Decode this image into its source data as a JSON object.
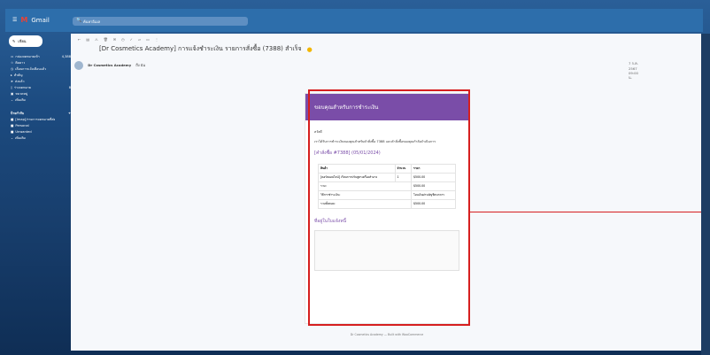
{
  "app": {
    "name": "Gmail",
    "compose": "เขียน"
  },
  "search": {
    "placeholder": "ค้นหาอีเมล"
  },
  "sidebar": {
    "items": [
      {
        "label": "กล่องจดหมายเข้า",
        "count": "4,388",
        "icon": "inbox-icon"
      },
      {
        "label": "ติดดาว",
        "icon": "star-icon"
      },
      {
        "label": "เลื่อนการแจ้งเตือนแล้ว",
        "icon": "clock-icon"
      },
      {
        "label": "สำคัญ",
        "icon": "important-icon"
      },
      {
        "label": "ส่งแล้ว",
        "icon": "send-icon"
      },
      {
        "label": "ร่างจดหมาย",
        "count": "8",
        "icon": "draft-icon"
      },
      {
        "label": "หมวดหมู่",
        "icon": "category-icon"
      },
      {
        "label": "เพิ่มเติม",
        "icon": "more-icon"
      }
    ],
    "labels_title": "ป้ายกำกับ",
    "labels": [
      {
        "label": "[Imap]/รายการจดหมายที่ส่ง",
        "color": "#ffffff"
      },
      {
        "label": "Personal",
        "color": "#ffffff"
      },
      {
        "label": "Unwanted",
        "color": "#ffffff"
      },
      {
        "label": "เพิ่มเติม",
        "color": "#ffffff"
      }
    ]
  },
  "email": {
    "subject": "[Dr Cosmetics Academy] การแจ้งชำระเงิน รายการสั่งซื้อ (7388) สำเร็จ",
    "sender": "Dr Cosmetics Academy",
    "to": "ถึง ฉัน",
    "date": "7 ก.ค. 2567 09:00 น.",
    "header_title": "ขอบคุณสำหรับการชำระเงิน",
    "greeting": "สวัสดี",
    "body_text": "เราได้รับการชำระเงินของคุณสำหรับคำสั่งซื้อ 7388 และคำสั่งซื้อของคุณกำลังดำเนินการ",
    "order_title": "[คำสั่งซื้อ #7388] (05/01/2024)",
    "table_headers": [
      "สินค้า",
      "จำนวน",
      "ราคา"
    ],
    "items": [
      {
        "name": "[คอร์สออนไลน์] เรียนการปรับสูตรเครื่องสำอาง",
        "qty": "1",
        "price": "$500.00"
      }
    ],
    "rows": [
      {
        "label": "รวม:",
        "value": "$500.00"
      },
      {
        "label": "วิธีการชำระเงิน:",
        "value": "โอนเงินผ่านบัญชีธนาคาร"
      },
      {
        "label": "รวมทั้งหมด:",
        "value": "$500.00"
      }
    ],
    "address_title": "ที่อยู่ในใบแจ้งหนี้",
    "footer": "Dr Cosmetics Academy — Built with WooCommerce"
  }
}
